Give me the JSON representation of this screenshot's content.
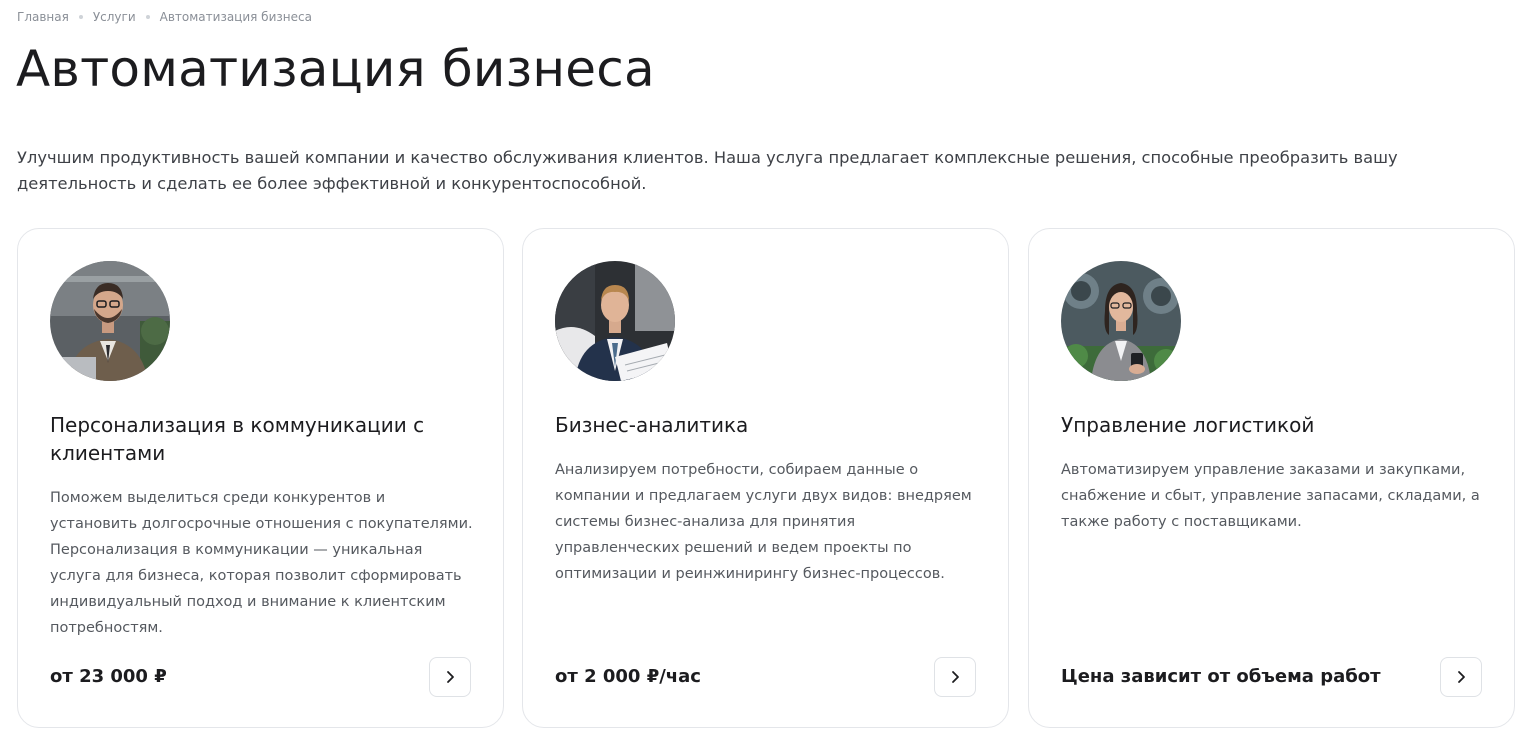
{
  "breadcrumb": {
    "items": [
      "Главная",
      "Услуги",
      "Автоматизация бизнеса"
    ]
  },
  "page": {
    "title": "Автоматизация бизнеса",
    "lead": "Улучшим продуктивность вашей компании и качество обслуживания клиентов. Наша услуга предлагает комплексные решения, способные преобразить вашу деятельность и сделать ее более эффективной и конкурентоспособной."
  },
  "cards": [
    {
      "title": "Персонализация в коммуникации с клиентами",
      "description": "Поможем выделиться среди конкурентов и установить долгосрочные отношения с покупателями. Персонализация в коммуникации — уникальная услуга для бизнеса, которая позволит сформировать индивидуальный подход и внимание к клиентским потребностям.",
      "price": "от 23 000 ₽",
      "icon": "chevron-right-icon"
    },
    {
      "title": "Бизнес-аналитика",
      "description": "Анализируем потребности, собираем данные о компании и предлагаем услуги двух видов: внедряем системы бизнес-анализа для принятия управленческих решений и ведем проекты по оптимизации и реинжинирингу бизнес-процессов.",
      "price": "от 2 000 ₽/час",
      "icon": "chevron-right-icon"
    },
    {
      "title": "Управление логистикой",
      "description": "Автоматизируем управление заказами и закупками, снабжение и сбыт, управление запасами, складами, а также работу с поставщиками.",
      "price": "Цена зависит от объема работ",
      "icon": "chevron-right-icon"
    }
  ]
}
